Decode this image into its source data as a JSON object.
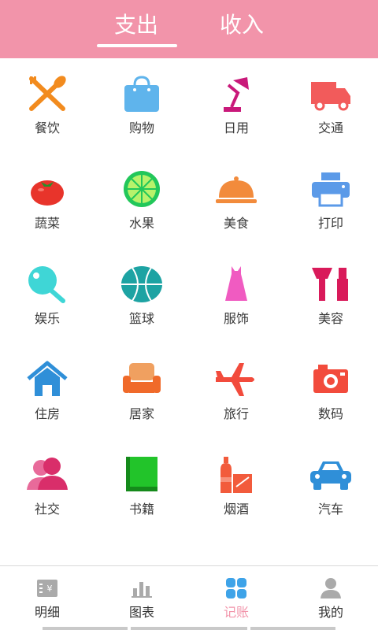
{
  "header": {
    "tabs": [
      {
        "label": "支出",
        "active": true
      },
      {
        "label": "收入",
        "active": false
      }
    ],
    "background_color": "#f294aa"
  },
  "categories": [
    {
      "label": "餐饮",
      "icon": "fork-knife-icon",
      "color": "#f28b1e"
    },
    {
      "label": "购物",
      "icon": "shopping-bag-icon",
      "color": "#5fb4ec"
    },
    {
      "label": "日用",
      "icon": "desk-lamp-icon",
      "color": "#c9197a"
    },
    {
      "label": "交通",
      "icon": "truck-icon",
      "color": "#f25b5b"
    },
    {
      "label": "蔬菜",
      "icon": "tomato-icon",
      "color": "#e8342b"
    },
    {
      "label": "水果",
      "icon": "lime-icon",
      "color": "#22c75a"
    },
    {
      "label": "美食",
      "icon": "food-cloche-icon",
      "color": "#f28b3c"
    },
    {
      "label": "打印",
      "icon": "printer-icon",
      "color": "#5b9ae8"
    },
    {
      "label": "娱乐",
      "icon": "ping-pong-icon",
      "color": "#3fd6d6"
    },
    {
      "label": "篮球",
      "icon": "basketball-icon",
      "color": "#1da3a3"
    },
    {
      "label": "服饰",
      "icon": "dress-icon",
      "color": "#f05bc1"
    },
    {
      "label": "美容",
      "icon": "makeup-icon",
      "color": "#d91a5a"
    },
    {
      "label": "住房",
      "icon": "house-icon",
      "color": "#2f8fd8"
    },
    {
      "label": "居家",
      "icon": "sofa-icon",
      "color": "#f06a2a"
    },
    {
      "label": "旅行",
      "icon": "airplane-icon",
      "color": "#f24b3c"
    },
    {
      "label": "数码",
      "icon": "camera-icon",
      "color": "#f24b3c"
    },
    {
      "label": "社交",
      "icon": "people-icon",
      "color": "#d92e6a"
    },
    {
      "label": "书籍",
      "icon": "book-icon",
      "color": "#22c42a"
    },
    {
      "label": "烟酒",
      "icon": "bottle-icon",
      "color": "#f25b3c"
    },
    {
      "label": "汽车",
      "icon": "car-icon",
      "color": "#2f8fd8"
    }
  ],
  "bottom_nav": [
    {
      "label": "明细",
      "icon": "bill-icon",
      "active": false
    },
    {
      "label": "图表",
      "icon": "bar-chart-icon",
      "active": false
    },
    {
      "label": "记账",
      "icon": "grid-four-icon",
      "active": true
    },
    {
      "label": "我的",
      "icon": "user-icon",
      "active": false
    }
  ],
  "accent_color": "#f294aa"
}
